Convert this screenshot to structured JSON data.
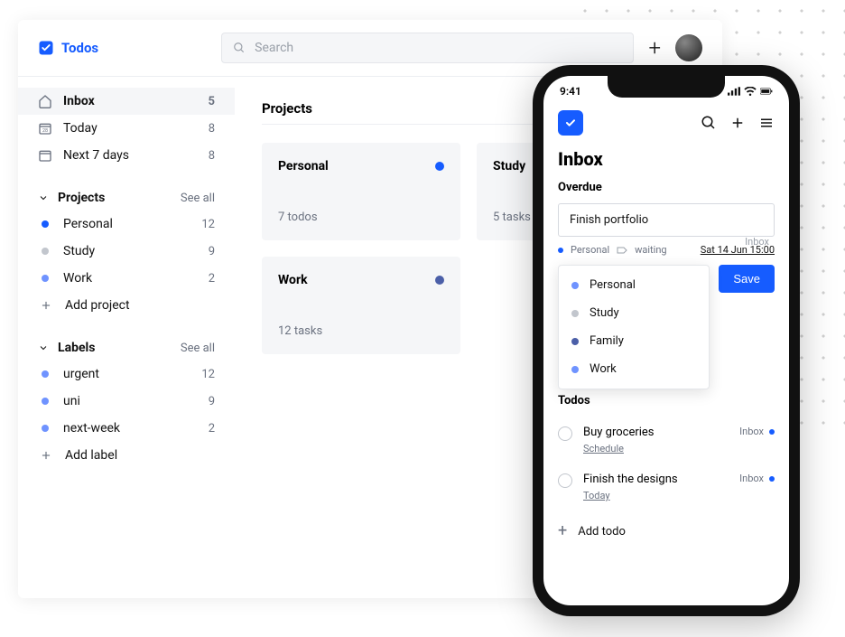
{
  "app_name": "Todos",
  "search": {
    "placeholder": "Search"
  },
  "side_nav": [
    {
      "label": "Inbox",
      "count": 5,
      "icon": "home"
    },
    {
      "label": "Today",
      "count": 8,
      "icon": "calendar-day"
    },
    {
      "label": "Next 7 days",
      "count": 8,
      "icon": "calendar-range"
    }
  ],
  "projects": {
    "title": "Projects",
    "see_all": "See all",
    "items": [
      {
        "label": "Personal",
        "count": 12,
        "color": "#165cff"
      },
      {
        "label": "Study",
        "count": 9,
        "color": "#c2c6cd"
      },
      {
        "label": "Work",
        "count": 2,
        "color": "#6f93ff"
      }
    ],
    "add": "Add project"
  },
  "labels": {
    "title": "Labels",
    "see_all": "See all",
    "items": [
      {
        "label": "urgent",
        "count": 12,
        "color": "#6f93ff"
      },
      {
        "label": "uni",
        "count": 9,
        "color": "#6f93ff"
      },
      {
        "label": "next-week",
        "count": 2,
        "color": "#6f93ff"
      }
    ],
    "add": "Add label"
  },
  "main": {
    "title": "Projects",
    "cards": [
      {
        "title": "Personal",
        "sub": "7 todos",
        "color": "#165cff"
      },
      {
        "title": "Study",
        "sub": "5 tasks",
        "color": "#c2c6cd"
      },
      {
        "title": "Work",
        "sub": "12 tasks",
        "color": "#4b5fa8"
      }
    ]
  },
  "mobile": {
    "time": "9:41",
    "title": "Inbox",
    "overdue": "Overdue",
    "input_value": "Finish portfolio",
    "tag_project": "Personal",
    "tag_label": "waiting",
    "date": "Sat 14 Jun 15:00",
    "save": "Save",
    "inbox_tag": "Inbox",
    "dropdown": [
      {
        "label": "Personal",
        "color": "#6f93ff"
      },
      {
        "label": "Study",
        "color": "#c2c6cd"
      },
      {
        "label": "Family",
        "color": "#4b5fa8"
      },
      {
        "label": "Work",
        "color": "#6f93ff"
      }
    ],
    "todos_title": "Todos",
    "todos": [
      {
        "label": "Buy groceries",
        "sched": "Schedule",
        "tag": "Inbox"
      },
      {
        "label": "Finish the designs",
        "sched": "Today",
        "tag": "Inbox"
      }
    ],
    "add_todo": "Add todo"
  }
}
